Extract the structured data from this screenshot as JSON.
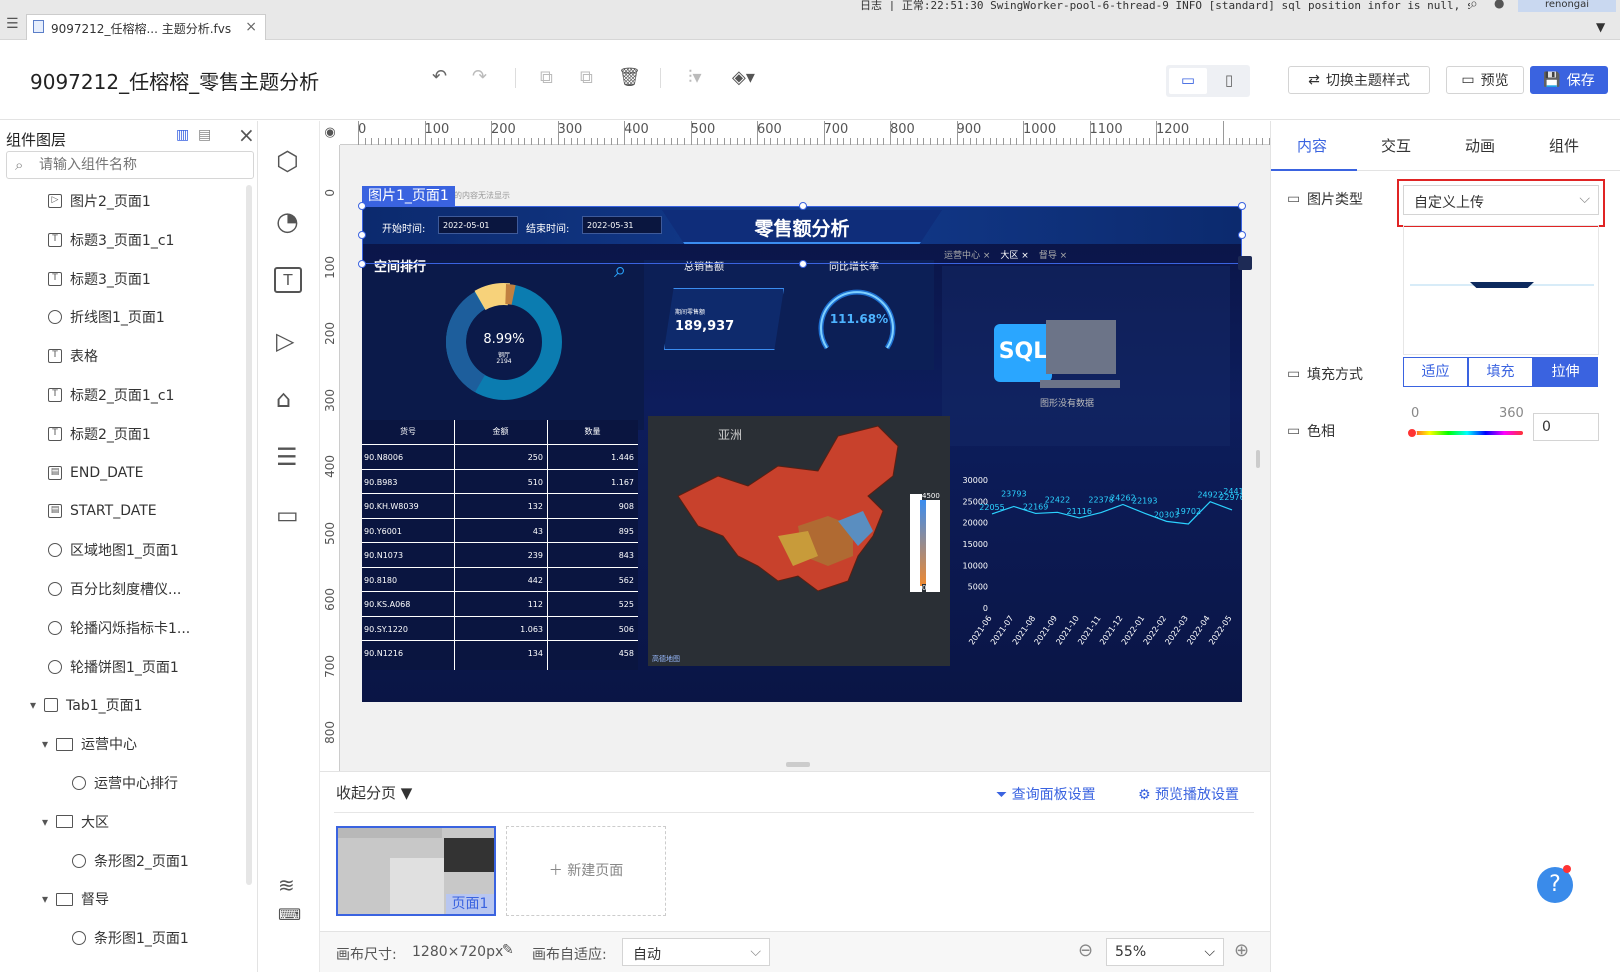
{
  "browser_tab": {
    "title": "9097212_任榕榕... 主题分析.fvs",
    "close": "×"
  },
  "topbar": {
    "log_text": "日志 | 正常:22:51:30 SwingWorker-pool-6-thread-9 INFO [standard] sql position infor is null, sql ...",
    "user": "renongai"
  },
  "header": {
    "title": "9097212_任榕榕_零售主题分析",
    "switch_theme": "切换主题样式",
    "preview": "预览",
    "save": "保存"
  },
  "layers": {
    "title": "组件图层",
    "search_placeholder": "请输入组件名称",
    "items": [
      {
        "label": "图片2_页面1",
        "icon": "image-icon",
        "level": 0
      },
      {
        "label": "标题3_页面1_c1",
        "icon": "text-icon",
        "level": 0
      },
      {
        "label": "标题3_页面1",
        "icon": "text-icon",
        "level": 0
      },
      {
        "label": "折线图1_页面1",
        "icon": "chart-icon",
        "level": 0
      },
      {
        "label": "表格",
        "icon": "text-icon",
        "level": 0
      },
      {
        "label": "标题2_页面1_c1",
        "icon": "text-icon",
        "level": 0
      },
      {
        "label": "标题2_页面1",
        "icon": "text-icon",
        "level": 0
      },
      {
        "label": "END_DATE",
        "icon": "date-icon",
        "level": 0
      },
      {
        "label": "START_DATE",
        "icon": "date-icon",
        "level": 0
      },
      {
        "label": "区域地图1_页面1",
        "icon": "chart-icon",
        "level": 0
      },
      {
        "label": "百分比刻度槽仪...",
        "icon": "chart-icon",
        "level": 0
      },
      {
        "label": "轮播闪烁指标卡1...",
        "icon": "chart-icon",
        "level": 0
      },
      {
        "label": "轮播饼图1_页面1",
        "icon": "chart-icon",
        "level": 0
      },
      {
        "label": "Tab1_页面1",
        "icon": "tab-icon",
        "level": 0,
        "expanded": true
      },
      {
        "label": "运营中心",
        "icon": "folder-icon",
        "level": 1,
        "expanded": true
      },
      {
        "label": "运营中心排行",
        "icon": "chart-icon",
        "level": 2
      },
      {
        "label": "大区",
        "icon": "folder-icon",
        "level": 1,
        "expanded": true
      },
      {
        "label": "条形图2_页面1",
        "icon": "chart-icon",
        "level": 2
      },
      {
        "label": "督导",
        "icon": "folder-icon",
        "level": 1,
        "expanded": true
      },
      {
        "label": "条形图1_页面1",
        "icon": "chart-icon",
        "level": 2
      }
    ]
  },
  "ruler": {
    "h_ticks": [
      "0",
      "100",
      "200",
      "300",
      "400",
      "500",
      "600",
      "700",
      "800",
      "900",
      "1000",
      "1100",
      "1200"
    ],
    "v_ticks": [
      "0",
      "100",
      "200",
      "300",
      "400",
      "500",
      "600",
      "700",
      "800"
    ]
  },
  "canvas": {
    "selected_label": "图片1_页面1",
    "note": "画布外的内容无法显示",
    "dashboard": {
      "title": "零售额分析",
      "start_label": "开始时间:",
      "start_value": "2022-05-01",
      "end_label": "结束时间:",
      "end_value": "2022-05-31",
      "rank_title": "空间排行",
      "donut_pct": "8.99%",
      "donut_name": "钢厅",
      "donut_val": "2194",
      "total_title": "总销售额",
      "total_label": "期间零售额",
      "total_value": "189,937",
      "growth_title": "同比增长率",
      "growth_value": "111.68%",
      "tabs": [
        "运营中心 ×",
        "大区 ×",
        "督导 ×"
      ],
      "sql_label": "SQL",
      "no_data": "图形没有数据",
      "map_label": "亚洲",
      "map_legend_max": "4500",
      "map_legend_min": "0",
      "map_source": "高德地图",
      "table_headers": [
        "货号",
        "金额",
        "数量"
      ],
      "table_rows": [
        [
          "90.N8006",
          "250",
          "1.446"
        ],
        [
          "90.B983",
          "510",
          "1.167"
        ],
        [
          "90.KH.W8039",
          "132",
          "908"
        ],
        [
          "90.Y6001",
          "43",
          "895"
        ],
        [
          "90.N1073",
          "239",
          "843"
        ],
        [
          "90.8180",
          "442",
          "562"
        ],
        [
          "90.KS.A068",
          "112",
          "525"
        ],
        [
          "90.SY.1220",
          "1.063",
          "506"
        ],
        [
          "90.N1216",
          "134",
          "458"
        ]
      ]
    }
  },
  "chart_data": {
    "type": "line",
    "categories": [
      "2021-06",
      "2021-07",
      "2021-08",
      "2021-09",
      "2021-10",
      "2021-11",
      "2021-12",
      "2022-01",
      "2022-02",
      "2022-03",
      "2022-04",
      "2022-05"
    ],
    "values": [
      22055,
      23793,
      22169,
      22422,
      21116,
      22378,
      24262,
      22193,
      20303,
      19702,
      24922,
      22976
    ],
    "labels_extra": [
      24418
    ],
    "y_ticks": [
      "30000",
      "25000",
      "20000",
      "15000",
      "10000",
      "5000",
      "0"
    ],
    "ylim": [
      0,
      30000
    ],
    "color": "#2bd2ff"
  },
  "pages": {
    "collapse_label": "收起分页",
    "query_settings": "查询面板设置",
    "preview_settings": "预览播放设置",
    "page1": "页面1",
    "new_page": "新建页面"
  },
  "status": {
    "canvas_size_label": "画布尺寸:",
    "canvas_size_value": "1280×720px",
    "fit_label": "画布自适应:",
    "fit_value": "自动",
    "zoom": "55%"
  },
  "props": {
    "tabs": [
      "内容",
      "交互",
      "动画",
      "组件"
    ],
    "image_type_label": "图片类型",
    "image_type_value": "自定义上传",
    "fill_label": "填充方式",
    "fill_options": [
      "适应",
      "填充",
      "拉伸"
    ],
    "hue_label": "色相",
    "hue_min": "0",
    "hue_max": "360",
    "hue_value": "0",
    "accent": "#3a63e0",
    "highlight": "#e02424"
  }
}
